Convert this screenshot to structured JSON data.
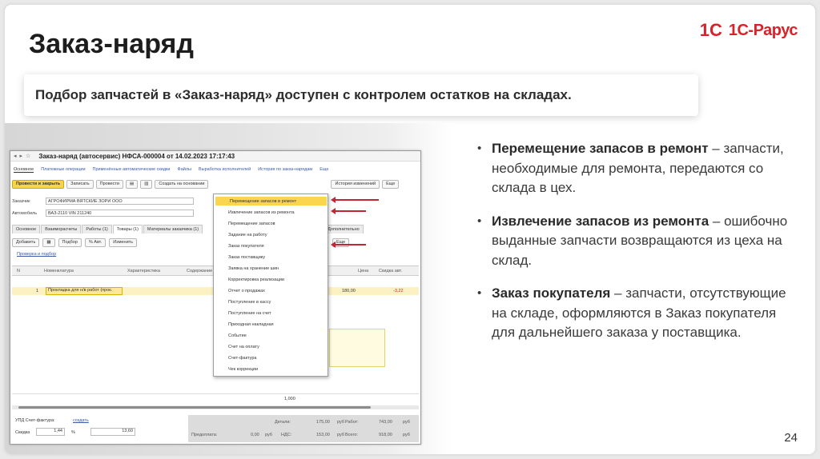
{
  "slide": {
    "title": "Заказ-наряд",
    "banner": "Подбор запчастей в «Заказ-наряд» доступен с контролем остатков на складах.",
    "page_number": "24",
    "logo": {
      "mark": "1С",
      "brand": "1С-Рарус"
    }
  },
  "bullets": [
    {
      "heading": "Перемещение запасов в ремонт",
      "text": " – запчасти, необходимые для ремонта, передаются со склада в цех."
    },
    {
      "heading": "Извлечение запасов из ремонта",
      "text": " – ошибочно выданные запчасти возвращаются из цеха на склад."
    },
    {
      "heading": "Заказ покупателя",
      "text": " – запчасти, отсутствующие на складе, оформляются в Заказ покупателя для дальнейшего заказа у поставщика."
    }
  ],
  "screen": {
    "window_title": "Заказ-наряд (автосервис) НФСА-000004 от 14.02.2023 17:17:43",
    "nav_links": [
      "Основное",
      "Платежные операции",
      "Применённые автоматические скидки",
      "Файлы",
      "Выработка исполнителей",
      "История по заказ-нарядам",
      "Еще"
    ],
    "toolbar": {
      "post_close": "Провести и закрыть",
      "write": "Записать",
      "post": "Провести",
      "create_based": "Создать на основании",
      "history": "История изменений",
      "more": "Еще"
    },
    "fields": [
      {
        "label": "Заказчик",
        "value": "АГРОФИРМА ВЯТСКИЕ ЗОРИ ООО"
      },
      {
        "label": "Автомобиль",
        "value": "ВАЗ-2110 VIN 211240"
      }
    ],
    "tabs": [
      "Основное",
      "Взаиморасчеты",
      "Работы (1)",
      "Товары (1)",
      "Материалы заказчика (1)",
      "Дополнительно"
    ],
    "subtool": {
      "add": "Добавить",
      "select": "Подбор",
      "percent": "% Авт.",
      "change": "Изменить",
      "more": "Еще"
    },
    "link": "Проверка и подбор",
    "columns": [
      "N",
      "Номенклатура",
      "Характеристика",
      "Содержание",
      "Цена",
      "Скидка авт."
    ],
    "row": {
      "n": "1",
      "name": "Прокладка для н/в работ (прок.",
      "price": "180,00",
      "discount": "-3,22"
    },
    "quantity_total": "1,000",
    "dropdown_items": [
      "Перемещение запасов в ремонт",
      "Извлечение запасов из ремонта",
      "Перемещение запасов",
      "Задание на работу",
      "Заказ покупателя",
      "Заказ поставщику",
      "Заявка на хранение шин",
      "Корректировка реализации",
      "Отчет о продажах",
      "Поступление в кассу",
      "Поступление на счет",
      "Приходная накладная",
      "Событие",
      "Счет на оплату",
      "Счет-фактура",
      "Чек коррекции"
    ],
    "footer": {
      "invoice": "УПД  Счет-фактура:",
      "create": "создать",
      "discount_label": "Скидка",
      "discount_value": "1,44",
      "percent": "%",
      "discount_sum": "13,60"
    },
    "totals": {
      "goods_label": "Детали:",
      "goods": "175,00",
      "works_label": "Работ:",
      "works": "743,00",
      "prepay_label": "Предоплата:",
      "prepay": "0,00",
      "vat_label": "НДС:",
      "vat": "153,00",
      "total_label": "Всего:",
      "total": "918,00",
      "currency": "руб"
    }
  }
}
